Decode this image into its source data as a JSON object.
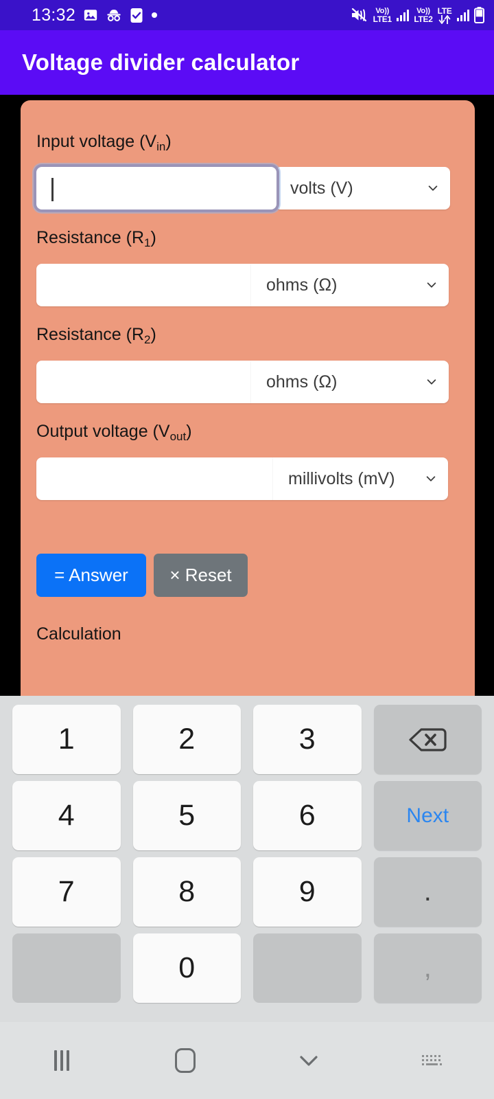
{
  "status_bar": {
    "time": "13:32",
    "left_icons": [
      "image-icon",
      "incognito-icon",
      "tasks-checkbox-icon",
      "dot-icon"
    ],
    "sim1_volte": "Vo))",
    "sim1_label": "LTE1",
    "sim2_volte": "Vo))",
    "sim2_label": "LTE2",
    "network_label": "LTE",
    "right_icons": [
      "mute-icon",
      "signal-bars-icon",
      "data-arrows-icon",
      "battery-icon"
    ],
    "background_color": "#3a12c9"
  },
  "app_bar": {
    "title": "Voltage divider calculator",
    "background_color": "#5b0cf5",
    "text_color": "#ffffff"
  },
  "card": {
    "background_color": "#ed9a7d"
  },
  "form": {
    "fields": [
      {
        "label_text": "Input voltage (V",
        "label_sub": "in",
        "label_close": ")",
        "value": "",
        "placeholder": "",
        "unit": "volts (V)",
        "focused": true
      },
      {
        "label_text": "Resistance (R",
        "label_sub": "1",
        "label_close": ")",
        "value": "",
        "placeholder": "",
        "unit": "ohms (Ω)",
        "focused": false
      },
      {
        "label_text": "Resistance (R",
        "label_sub": "2",
        "label_close": ")",
        "value": "",
        "placeholder": "",
        "unit": "ohms (Ω)",
        "focused": false
      },
      {
        "label_text": "Output voltage (V",
        "label_sub": "out",
        "label_close": ")",
        "value": "",
        "placeholder": "",
        "unit": "millivolts (mV)",
        "focused": false
      }
    ],
    "answer_button": "= Answer",
    "reset_button": "× Reset",
    "answer_color": "#0b72f7",
    "reset_color": "#6e757a",
    "calculation_heading": "Calculation"
  },
  "keyboard": {
    "rows": [
      [
        {
          "label": "1",
          "type": "num",
          "name": "key-1"
        },
        {
          "label": "2",
          "type": "num",
          "name": "key-2"
        },
        {
          "label": "3",
          "type": "num",
          "name": "key-3"
        },
        {
          "label": "",
          "type": "backspace",
          "name": "key-backspace"
        }
      ],
      [
        {
          "label": "4",
          "type": "num",
          "name": "key-4"
        },
        {
          "label": "5",
          "type": "num",
          "name": "key-5"
        },
        {
          "label": "6",
          "type": "num",
          "name": "key-6"
        },
        {
          "label": "Next",
          "type": "next",
          "name": "key-next"
        }
      ],
      [
        {
          "label": "7",
          "type": "num",
          "name": "key-7"
        },
        {
          "label": "8",
          "type": "num",
          "name": "key-8"
        },
        {
          "label": "9",
          "type": "num",
          "name": "key-9"
        },
        {
          "label": ".",
          "type": "dot",
          "name": "key-period"
        }
      ],
      [
        {
          "label": "",
          "type": "blank",
          "name": "key-blank-left"
        },
        {
          "label": "0",
          "type": "num",
          "name": "key-0"
        },
        {
          "label": "",
          "type": "blank",
          "name": "key-blank-right"
        },
        {
          "label": ",",
          "type": "comma",
          "name": "key-comma"
        }
      ]
    ],
    "background_color": "#dadcdd",
    "next_color": "#2b86f0"
  },
  "nav_bar": {
    "items": [
      "recents-icon",
      "home-icon",
      "hide-keyboard-icon",
      "keyboard-switch-icon"
    ],
    "background_color": "#dfe1e2"
  }
}
